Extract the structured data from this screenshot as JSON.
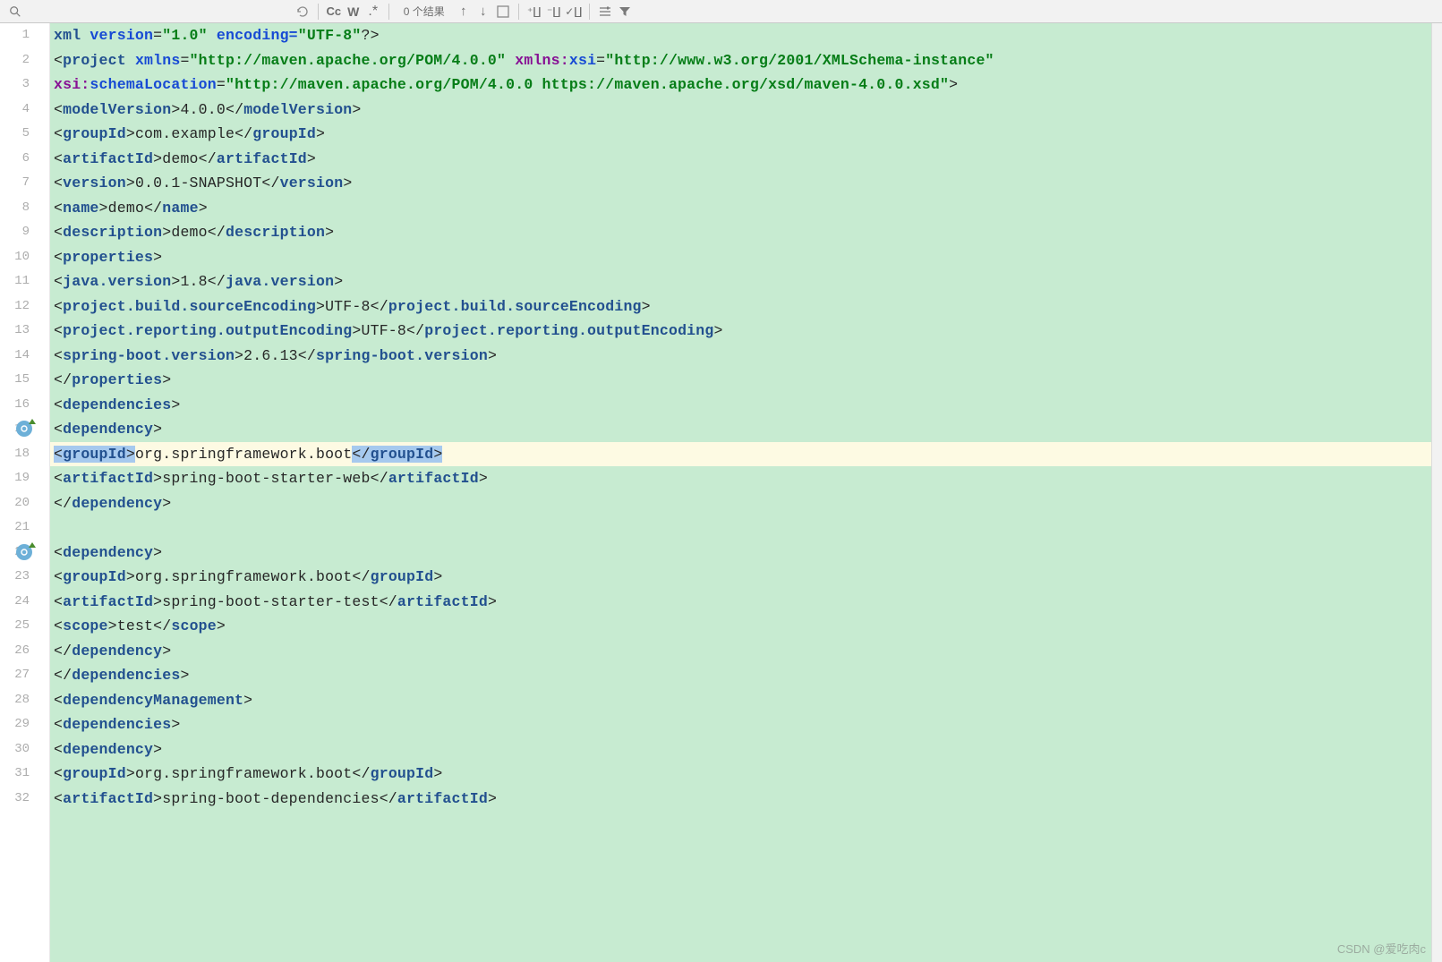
{
  "toolbar": {
    "results_label": "0 个结果"
  },
  "gutter_icons": [
    {
      "row": 16,
      "name": "maven-reimport-icon"
    },
    {
      "row": 21,
      "name": "maven-reimport-icon"
    }
  ],
  "watermark": "CSDN @爱吃肉c",
  "code_lines": [
    {
      "n": 1,
      "indent": 0,
      "type": "pi",
      "open": "<?",
      "kw": "xml",
      "rest": " version",
      "val1": "\"1.0\"",
      "rest2": " encoding=",
      "val2": "\"UTF-8\"",
      "close": "?>"
    },
    {
      "n": 2,
      "indent": 0,
      "type": "open2",
      "tag": "project",
      "attr1": "xmlns",
      "val1": "\"http://maven.apache.org/POM/4.0.0\"",
      "attr2p": "xmlns:",
      "attr2": "xsi",
      "val2": "\"http://www.w3.org/2001/XMLSchema-instance\""
    },
    {
      "n": 3,
      "indent": 9,
      "type": "attrline",
      "attrp": "xsi:",
      "attr": "schemaLocation",
      "val": "\"http://maven.apache.org/POM/4.0.0 https://maven.apache.org/xsd/maven-4.0.0.xsd\"",
      "close": ">"
    },
    {
      "n": 4,
      "indent": 4,
      "type": "simple",
      "tag": "modelVersion",
      "text": "4.0.0"
    },
    {
      "n": 5,
      "indent": 4,
      "type": "simple",
      "tag": "groupId",
      "text": "com.example"
    },
    {
      "n": 6,
      "indent": 4,
      "type": "simple",
      "tag": "artifactId",
      "text": "demo"
    },
    {
      "n": 7,
      "indent": 4,
      "type": "simple",
      "tag": "version",
      "text": "0.0.1-SNAPSHOT"
    },
    {
      "n": 8,
      "indent": 4,
      "type": "simple",
      "tag": "name",
      "text": "demo"
    },
    {
      "n": 9,
      "indent": 4,
      "type": "simple",
      "tag": "description",
      "text": "demo"
    },
    {
      "n": 10,
      "indent": 4,
      "type": "open",
      "tag": "properties"
    },
    {
      "n": 11,
      "indent": 8,
      "type": "simple",
      "tag": "java.version",
      "text": "1.8"
    },
    {
      "n": 12,
      "indent": 8,
      "type": "simple",
      "tag": "project.build.sourceEncoding",
      "text": "UTF-8"
    },
    {
      "n": 13,
      "indent": 8,
      "type": "simple",
      "tag": "project.reporting.outputEncoding",
      "text": "UTF-8"
    },
    {
      "n": 14,
      "indent": 8,
      "type": "simple",
      "tag": "spring-boot.version",
      "text": "2.6.13"
    },
    {
      "n": 15,
      "indent": 4,
      "type": "close",
      "tag": "properties"
    },
    {
      "n": 16,
      "indent": 4,
      "type": "open",
      "tag": "dependencies"
    },
    {
      "n": 17,
      "indent": 8,
      "type": "open",
      "tag": "dependency"
    },
    {
      "n": 18,
      "indent": 12,
      "type": "simple",
      "tag": "groupId",
      "text": "org.springframework.boot",
      "current": true,
      "seltags": true
    },
    {
      "n": 19,
      "indent": 12,
      "type": "simple",
      "tag": "artifactId",
      "text": "spring-boot-starter-web"
    },
    {
      "n": 20,
      "indent": 8,
      "type": "close",
      "tag": "dependency"
    },
    {
      "n": 21,
      "indent": 0,
      "type": "blank"
    },
    {
      "n": 22,
      "indent": 8,
      "type": "open",
      "tag": "dependency"
    },
    {
      "n": 23,
      "indent": 12,
      "type": "simple",
      "tag": "groupId",
      "text": "org.springframework.boot"
    },
    {
      "n": 24,
      "indent": 12,
      "type": "simple",
      "tag": "artifactId",
      "text": "spring-boot-starter-test"
    },
    {
      "n": 25,
      "indent": 12,
      "type": "simple",
      "tag": "scope",
      "text": "test"
    },
    {
      "n": 26,
      "indent": 8,
      "type": "close",
      "tag": "dependency"
    },
    {
      "n": 27,
      "indent": 4,
      "type": "close",
      "tag": "dependencies"
    },
    {
      "n": 28,
      "indent": 4,
      "type": "open",
      "tag": "dependencyManagement"
    },
    {
      "n": 29,
      "indent": 8,
      "type": "open",
      "tag": "dependencies"
    },
    {
      "n": 30,
      "indent": 12,
      "type": "open",
      "tag": "dependency"
    },
    {
      "n": 31,
      "indent": 16,
      "type": "simple",
      "tag": "groupId",
      "text": "org.springframework.boot"
    },
    {
      "n": 32,
      "indent": 16,
      "type": "simplecut",
      "tag": "artifactId",
      "text": "spring-boot-dependencies",
      "cut": true
    }
  ]
}
